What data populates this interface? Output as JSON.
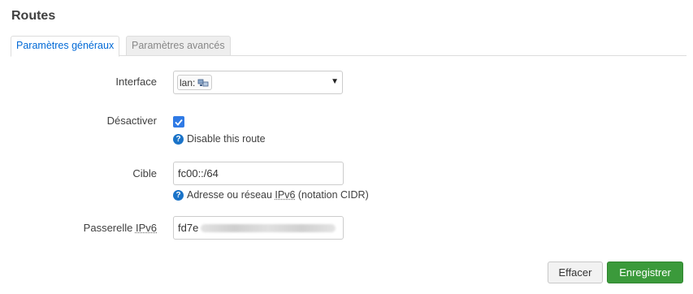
{
  "page": {
    "title": "Routes"
  },
  "tabs": [
    {
      "label": "Paramètres généraux",
      "active": true
    },
    {
      "label": "Paramètres avancés",
      "active": false
    }
  ],
  "fields": {
    "interface": {
      "label": "Interface",
      "value": "lan:",
      "icon": "network-icon"
    },
    "disable": {
      "label": "Désactiver",
      "checked": true,
      "help": "Disable this route"
    },
    "target": {
      "label": "Cible",
      "value": "fc00::/64",
      "help_prefix": "Adresse ou réseau ",
      "help_abbr": "IPv6",
      "help_suffix": " (notation CIDR)"
    },
    "gateway": {
      "label_prefix": "Passerelle ",
      "label_abbr": "IPv6",
      "value": "fd7e"
    }
  },
  "buttons": {
    "reset": "Effacer",
    "save": "Enregistrer"
  },
  "colors": {
    "accent": "#0069d6",
    "checkbox": "#2f7ae5",
    "save": "#3b9a3b"
  }
}
